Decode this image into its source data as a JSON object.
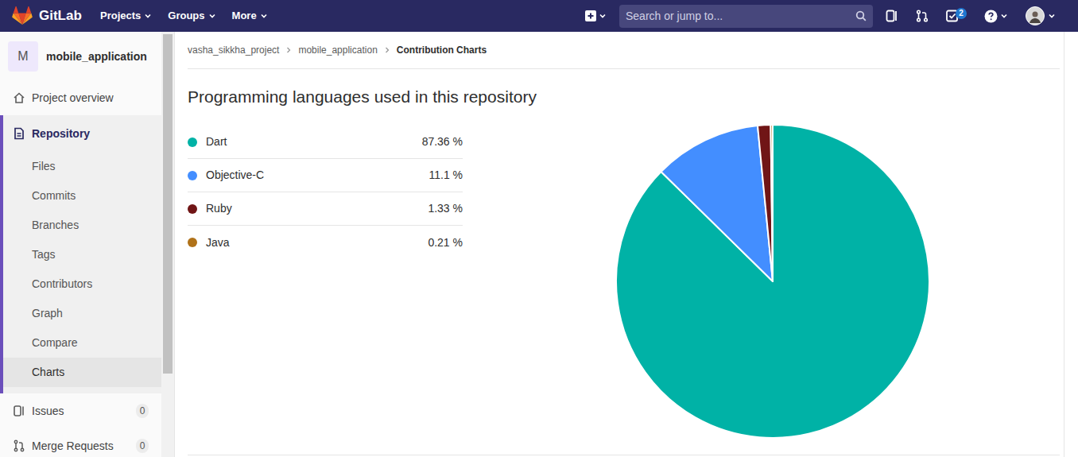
{
  "navbar": {
    "brand": "GitLab",
    "menus": [
      {
        "label": "Projects"
      },
      {
        "label": "Groups"
      },
      {
        "label": "More"
      }
    ],
    "search": {
      "placeholder": "Search or jump to..."
    },
    "todos_badge": "2"
  },
  "sidebar": {
    "project": {
      "avatar": "M",
      "name": "mobile_application"
    },
    "items": [
      {
        "label": "Project overview",
        "selected": false,
        "expanded": false,
        "children": []
      },
      {
        "label": "Repository",
        "selected": true,
        "expanded": true,
        "children": [
          {
            "label": "Files",
            "selected": false
          },
          {
            "label": "Commits",
            "selected": false
          },
          {
            "label": "Branches",
            "selected": false
          },
          {
            "label": "Tags",
            "selected": false
          },
          {
            "label": "Contributors",
            "selected": false
          },
          {
            "label": "Graph",
            "selected": false
          },
          {
            "label": "Compare",
            "selected": false
          },
          {
            "label": "Charts",
            "selected": true
          }
        ]
      },
      {
        "label": "Issues",
        "selected": false,
        "expanded": false,
        "children": [],
        "count": "0"
      },
      {
        "label": "Merge Requests",
        "selected": false,
        "expanded": false,
        "children": [],
        "count": "0"
      }
    ]
  },
  "breadcrumbs": [
    "vasha_sikkha_project",
    "mobile_application",
    "Contribution Charts"
  ],
  "chart": {
    "title": "Programming languages used in this repository",
    "languages": [
      {
        "name": "Dart",
        "percent": "87.36 %",
        "value": 87.36,
        "color": "#00b2a6"
      },
      {
        "name": "Objective-C",
        "percent": "11.1 %",
        "value": 11.1,
        "color": "#438eff"
      },
      {
        "name": "Ruby",
        "percent": "1.33 %",
        "value": 1.33,
        "color": "#701516"
      },
      {
        "name": "Java",
        "percent": "0.21 %",
        "value": 0.21,
        "color": "#b07219"
      }
    ]
  }
}
